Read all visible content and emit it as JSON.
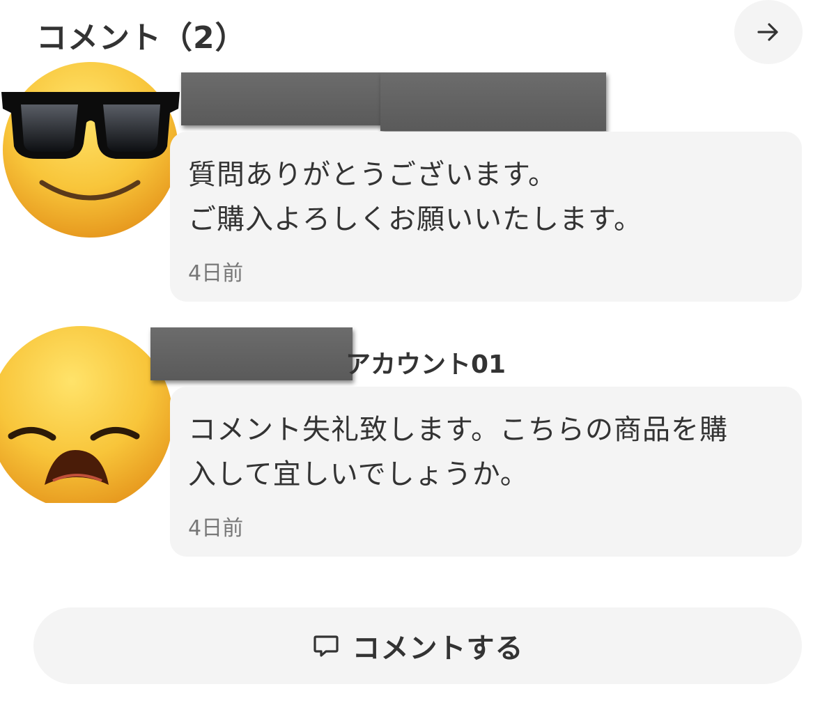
{
  "header": {
    "title": "コメント（2）",
    "next_icon": "arrow-right-icon"
  },
  "comments": [
    {
      "avatar_icon": "sunglasses-emoji-icon",
      "username_visible": "",
      "text": "質問ありがとうございます。\nご購入よろしくお願いいたします。",
      "time": "4日前"
    },
    {
      "avatar_icon": "pensive-emoji-icon",
      "username_visible": "アカウント01",
      "text": "コメント失礼致します。こちらの商品を購\n入して宜しいでしょうか。",
      "time": "4日前"
    }
  ],
  "comment_button": {
    "label": "コメントする",
    "icon": "speech-bubble-icon"
  },
  "colors": {
    "text": "#333333",
    "bubble_bg": "#f4f4f4",
    "muted": "#777777",
    "emoji_yellow": "#f7c338"
  }
}
